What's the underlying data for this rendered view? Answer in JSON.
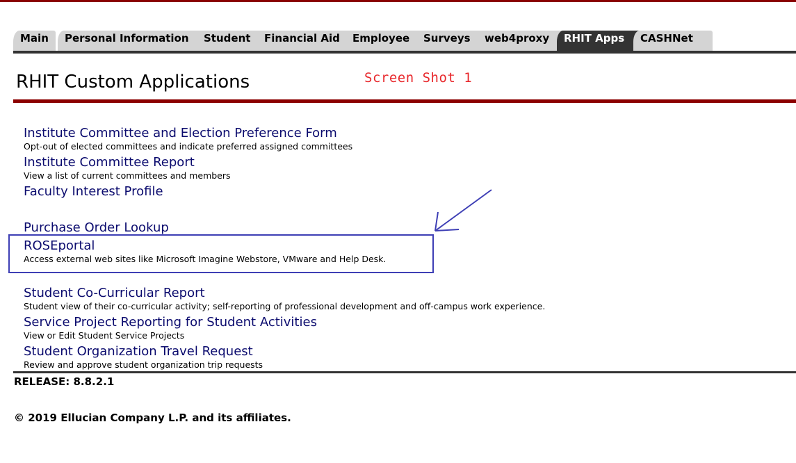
{
  "tabs": [
    {
      "label": "Main",
      "active": false
    },
    {
      "label": "Personal Information",
      "active": false
    },
    {
      "label": "Student",
      "active": false
    },
    {
      "label": "Financial Aid",
      "active": false
    },
    {
      "label": "Employee",
      "active": false
    },
    {
      "label": "Surveys",
      "active": false
    },
    {
      "label": "web4proxy",
      "active": false
    },
    {
      "label": "RHIT Apps",
      "active": true
    },
    {
      "label": "CASHNet",
      "active": false
    }
  ],
  "page": {
    "title": "RHIT Custom Applications",
    "annotation": "Screen Shot 1"
  },
  "apps": [
    {
      "link": "Institute Committee and Election Preference Form",
      "description": "Opt-out of elected committees and indicate preferred assigned committees"
    },
    {
      "link": "Institute Committee Report",
      "description": "View a list of current committees and members"
    },
    {
      "link": "Faculty Interest Profile",
      "description": ""
    },
    {
      "link": "Purchase Order Lookup",
      "description": ""
    },
    {
      "link": "ROSEportal",
      "description": "Access external web sites like Microsoft Imagine Webstore, VMware and Help Desk."
    },
    {
      "link": "Student Co-Curricular Report",
      "description": "Student view of their co-curricular activity; self-reporting of professional development and off-campus work experience."
    },
    {
      "link": "Service Project Reporting for Student Activities",
      "description": "View or Edit Student Service Projects"
    },
    {
      "link": "Student Organization Travel Request",
      "description": "Review and approve student organization trip requests"
    }
  ],
  "footer": {
    "release": "RELEASE: 8.8.2.1",
    "copyright": "© 2019 Ellucian Company L.P. and its affiliates."
  },
  "colors": {
    "accent_rule": "#8b0000",
    "link": "#0b0b6e",
    "active_tab": "#333333",
    "annotation_red": "#e8282c",
    "annotation_blue": "#3e3fb5"
  }
}
